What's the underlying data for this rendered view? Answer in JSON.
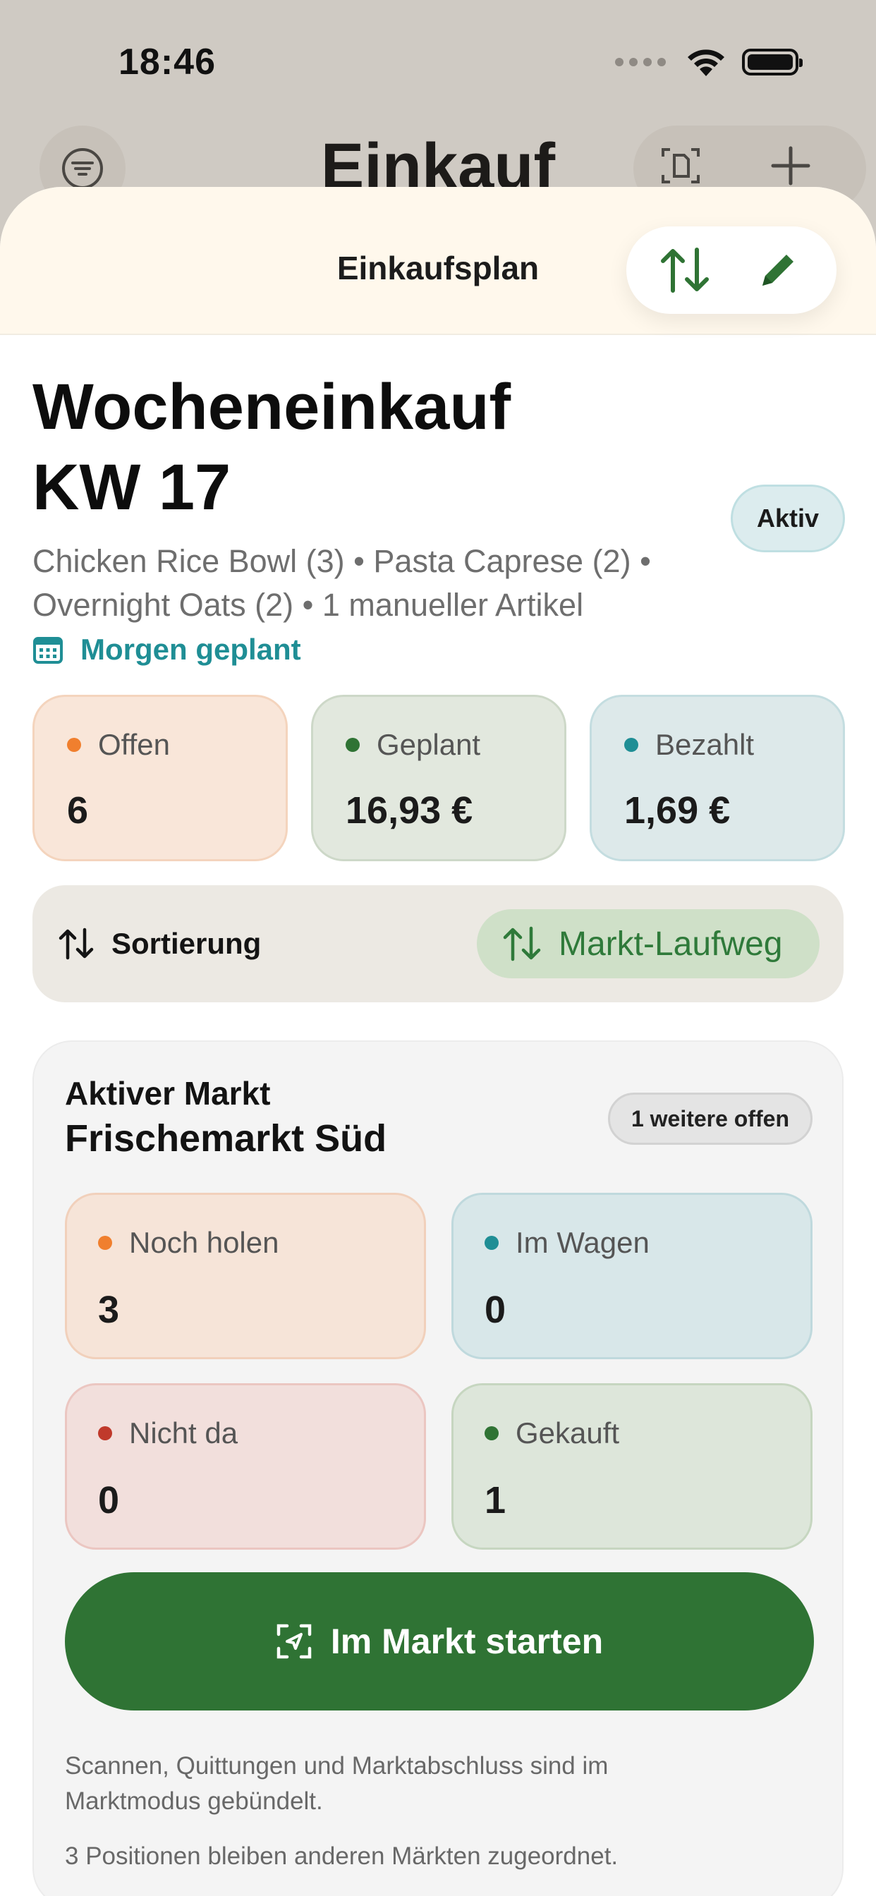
{
  "status_bar": {
    "time": "18:46"
  },
  "background_nav": {
    "title": "Einkauf"
  },
  "sheet": {
    "title": "Einkaufsplan"
  },
  "plan": {
    "title_line1": "Wocheneinkauf",
    "title_line2": "KW 17",
    "status": "Aktiv",
    "summary": "Chicken Rice Bowl (3) • Pasta Caprese (2) • Overnight Oats (2) • 1 manueller Artikel",
    "schedule": "Morgen geplant"
  },
  "stats": [
    {
      "label": "Offen",
      "value": "6",
      "color": "#f07f2e"
    },
    {
      "label": "Geplant",
      "value": "16,93 €",
      "color": "#2f7334"
    },
    {
      "label": "Bezahlt",
      "value": "1,69 €",
      "color": "#1f8e95"
    }
  ],
  "sort": {
    "label": "Sortierung",
    "value": "Markt-Laufweg"
  },
  "market": {
    "kicker": "Aktiver Markt",
    "name": "Frischemarkt Süd",
    "badge": "1 weitere offen",
    "stats": [
      {
        "label": "Noch holen",
        "value": "3",
        "color": "#f07f2e"
      },
      {
        "label": "Im Wagen",
        "value": "0",
        "color": "#1f8e95"
      },
      {
        "label": "Nicht da",
        "value": "0",
        "color": "#c0392b"
      },
      {
        "label": "Gekauft",
        "value": "1",
        "color": "#2f7334"
      }
    ],
    "start_button": "Im Markt starten",
    "note": "Scannen, Quittungen und Marktabschluss sind im Marktmodus gebündelt.",
    "note_2": "3 Positionen bleiben anderen Märkten zugeordnet."
  },
  "colors": {
    "accent_green": "#2f7334",
    "accent_teal": "#1f8e95",
    "accent_orange": "#f07f2e"
  }
}
